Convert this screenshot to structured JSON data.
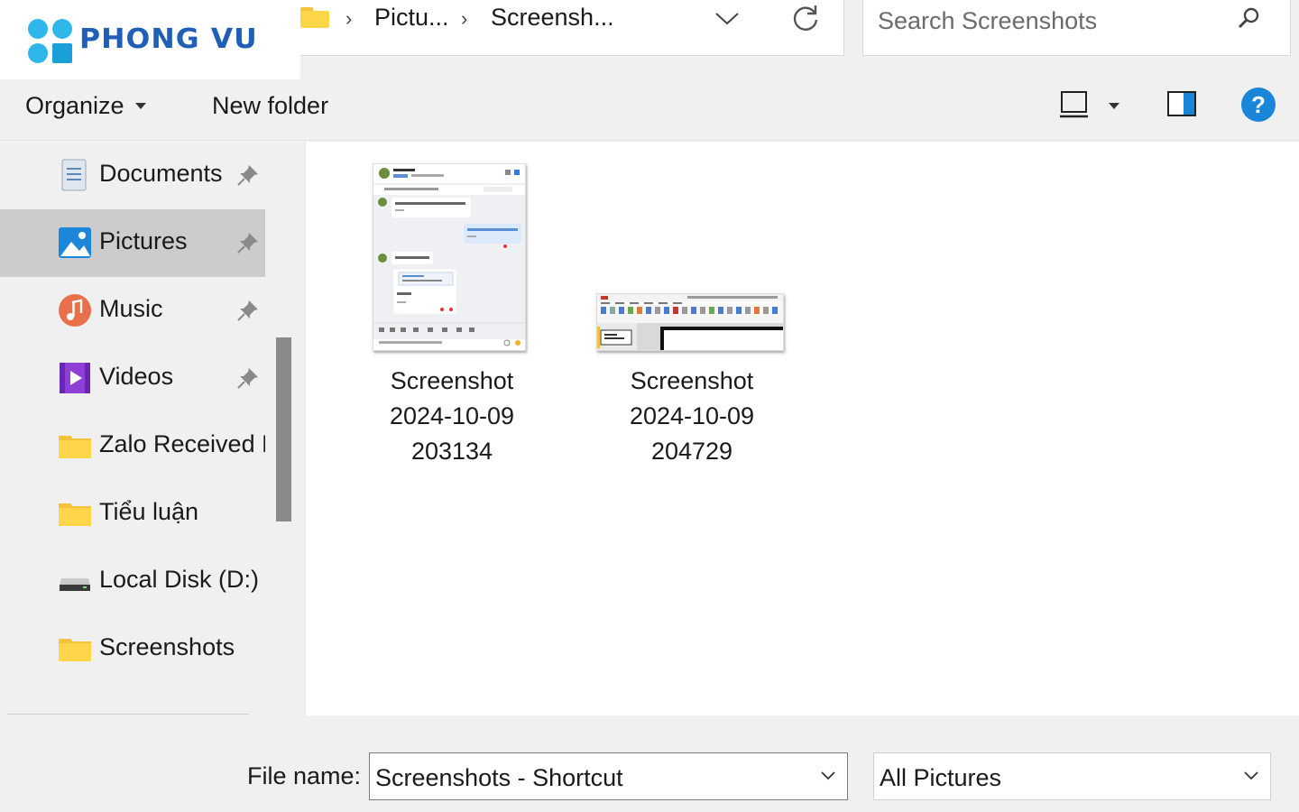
{
  "logo": {
    "text": "PHONG VU"
  },
  "address_bar": {
    "crumbs": [
      "Pictu...",
      "Screensh..."
    ],
    "dropdown_icon": "chevron-down-icon",
    "refresh_icon": "refresh-icon"
  },
  "search": {
    "placeholder": "Search Screenshots",
    "icon": "search-icon"
  },
  "toolbar": {
    "organize_label": "Organize",
    "new_folder_label": "New folder",
    "view_icon": "view-layout-icon",
    "preview_pane_icon": "preview-pane-icon",
    "help_icon": "help-icon"
  },
  "sidebar": {
    "items": [
      {
        "label": "Documents",
        "icon": "documents-icon",
        "pinned": true,
        "selected": false
      },
      {
        "label": "Pictures",
        "icon": "pictures-icon",
        "pinned": true,
        "selected": true
      },
      {
        "label": "Music",
        "icon": "music-icon",
        "pinned": true,
        "selected": false
      },
      {
        "label": "Videos",
        "icon": "videos-icon",
        "pinned": true,
        "selected": false
      },
      {
        "label": "Zalo Received F",
        "icon": "folder-icon",
        "pinned": false,
        "selected": false
      },
      {
        "label": "Tiểu luận",
        "icon": "folder-icon",
        "pinned": false,
        "selected": false
      },
      {
        "label": "Local Disk (D:)",
        "icon": "drive-icon",
        "pinned": false,
        "selected": false
      },
      {
        "label": "Screenshots",
        "icon": "folder-icon",
        "pinned": false,
        "selected": false
      }
    ]
  },
  "files": [
    {
      "name_lines": [
        "Screenshot",
        "2024-10-09",
        "203134"
      ]
    },
    {
      "name_lines": [
        "Screenshot",
        "2024-10-09",
        "204729"
      ]
    }
  ],
  "bottom": {
    "file_name_label": "File name:",
    "file_name_value": "Screenshots - Shortcut",
    "file_type_value": "All Pictures"
  },
  "colors": {
    "accent_blue": "#0078d4",
    "selected_bg": "#cccccc",
    "folder_yellow": "#ffd54a",
    "logo_blue": "#1f5fb8"
  }
}
